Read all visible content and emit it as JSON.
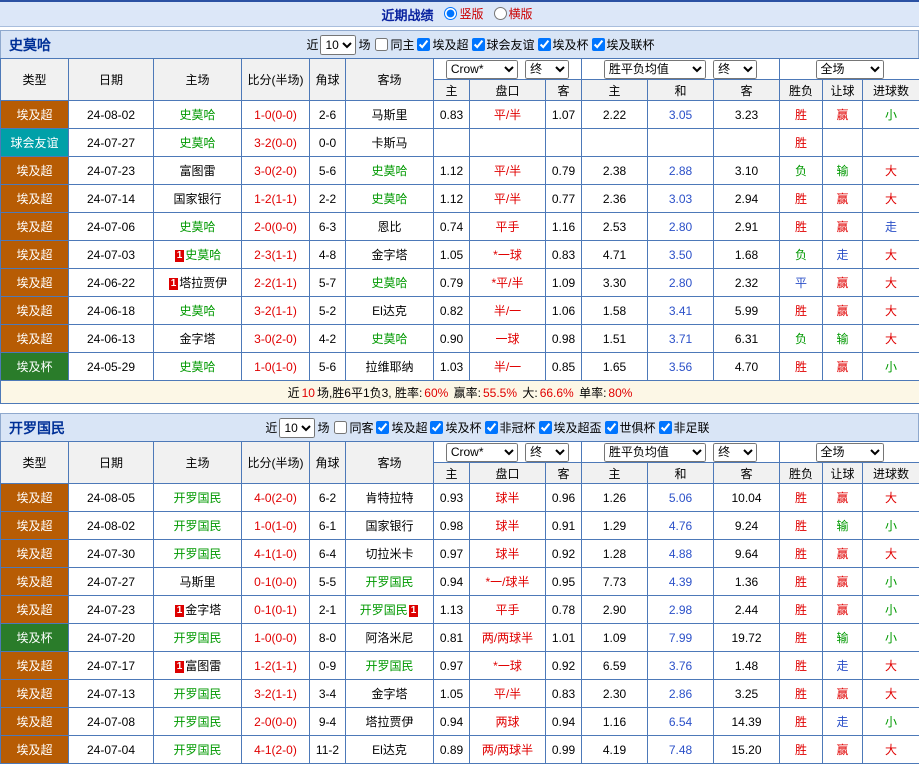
{
  "topbar": {
    "title": "近期战绩",
    "layout_options": [
      {
        "label": "竖版",
        "selected": true
      },
      {
        "label": "横版",
        "selected": false
      }
    ]
  },
  "colors": {
    "accent_red": "#e00000",
    "accent_green": "#009900",
    "accent_blue": "#2b50c8",
    "league_super_bg": "#b75c04",
    "league_friendly_bg": "#00a0a8",
    "league_cup_bg": "#2a7c2a",
    "bar_bg": "#d9e5f6",
    "table_border": "#4d79b8",
    "title_blue": "#0a23a0"
  },
  "table_header": {
    "cols": [
      "类型",
      "日期",
      "主场",
      "比分(半场)",
      "角球",
      "客场"
    ],
    "provider": "Crow*",
    "final": "终",
    "europe_avg": "胜平负均值",
    "full": "全场",
    "sub": [
      "主",
      "盘口",
      "客",
      "主",
      "和",
      "客",
      "胜负",
      "让球",
      "进球数"
    ]
  },
  "sections": [
    {
      "team": "史莫哈",
      "filter": {
        "near_label": "近",
        "games_value": "10",
        "games_label": "场",
        "checkboxes": [
          {
            "label": "同主",
            "checked": false
          },
          {
            "label": "埃及超",
            "checked": true
          },
          {
            "label": "球会友谊",
            "checked": true
          },
          {
            "label": "埃及杯",
            "checked": true
          },
          {
            "label": "埃及联杯",
            "checked": true
          }
        ]
      },
      "rows": [
        {
          "type": "埃及超",
          "league": "super",
          "date": "24-08-02",
          "home": {
            "name": "史莫哈",
            "self": true
          },
          "score": "1-0(0-0)",
          "corner": "2-6",
          "away": {
            "name": "马斯里",
            "self": false
          },
          "asia": [
            "0.83",
            "平/半",
            "1.07"
          ],
          "europe": [
            "2.22",
            "3.05",
            "3.23"
          ],
          "spf": [
            "胜",
            "w"
          ],
          "rq": [
            "赢",
            "w"
          ],
          "dx": [
            "小",
            "l"
          ]
        },
        {
          "type": "球会友谊",
          "league": "friendly",
          "date": "24-07-27",
          "home": {
            "name": "史莫哈",
            "self": true
          },
          "score": "3-2(0-0)",
          "corner": "0-0",
          "away": {
            "name": "卡斯马",
            "self": false
          },
          "asia": [
            "",
            "",
            ""
          ],
          "europe": [
            "",
            "",
            ""
          ],
          "spf": [
            "胜",
            "w"
          ],
          "rq": [
            "",
            ""
          ],
          "dx": [
            "",
            ""
          ]
        },
        {
          "type": "埃及超",
          "league": "super",
          "date": "24-07-23",
          "home": {
            "name": "富图雷",
            "self": false
          },
          "score": "3-0(2-0)",
          "corner": "5-6",
          "away": {
            "name": "史莫哈",
            "self": true
          },
          "asia": [
            "1.12",
            "平/半",
            "0.79"
          ],
          "europe": [
            "2.38",
            "2.88",
            "3.10"
          ],
          "spf": [
            "负",
            "l"
          ],
          "rq": [
            "输",
            "l"
          ],
          "dx": [
            "大",
            "w"
          ]
        },
        {
          "type": "埃及超",
          "league": "super",
          "date": "24-07-14",
          "home": {
            "name": "国家银行",
            "self": false
          },
          "score": "1-2(1-1)",
          "corner": "2-2",
          "away": {
            "name": "史莫哈",
            "self": true
          },
          "asia": [
            "1.12",
            "平/半",
            "0.77"
          ],
          "europe": [
            "2.36",
            "3.03",
            "2.94"
          ],
          "spf": [
            "胜",
            "w"
          ],
          "rq": [
            "赢",
            "w"
          ],
          "dx": [
            "大",
            "w"
          ]
        },
        {
          "type": "埃及超",
          "league": "super",
          "date": "24-07-06",
          "home": {
            "name": "史莫哈",
            "self": true
          },
          "score": "2-0(0-0)",
          "corner": "6-3",
          "away": {
            "name": "恩比",
            "self": false
          },
          "asia": [
            "0.74",
            "平手",
            "1.16"
          ],
          "europe": [
            "2.53",
            "2.80",
            "2.91"
          ],
          "spf": [
            "胜",
            "w"
          ],
          "rq": [
            "赢",
            "w"
          ],
          "dx": [
            "走",
            "d"
          ]
        },
        {
          "type": "埃及超",
          "league": "super",
          "date": "24-07-03",
          "home": {
            "name": "史莫哈",
            "self": true,
            "badge_pre": "1"
          },
          "score": "2-3(1-1)",
          "corner": "4-8",
          "away": {
            "name": "金字塔",
            "self": false
          },
          "asia": [
            "1.05",
            "*一球",
            "0.83"
          ],
          "europe": [
            "4.71",
            "3.50",
            "1.68"
          ],
          "spf": [
            "负",
            "l"
          ],
          "rq": [
            "走",
            "d"
          ],
          "dx": [
            "大",
            "w"
          ]
        },
        {
          "type": "埃及超",
          "league": "super",
          "date": "24-06-22",
          "home": {
            "name": "塔拉贾伊",
            "self": false,
            "badge_pre": "1"
          },
          "score": "2-2(1-1)",
          "corner": "5-7",
          "away": {
            "name": "史莫哈",
            "self": true
          },
          "asia": [
            "0.79",
            "*平/半",
            "1.09"
          ],
          "europe": [
            "3.30",
            "2.80",
            "2.32"
          ],
          "spf": [
            "平",
            "d"
          ],
          "rq": [
            "赢",
            "w"
          ],
          "dx": [
            "大",
            "w"
          ]
        },
        {
          "type": "埃及超",
          "league": "super",
          "date": "24-06-18",
          "home": {
            "name": "史莫哈",
            "self": true
          },
          "score": "3-2(1-1)",
          "corner": "5-2",
          "away": {
            "name": "El达克",
            "self": false
          },
          "asia": [
            "0.82",
            "半/一",
            "1.06"
          ],
          "europe": [
            "1.58",
            "3.41",
            "5.99"
          ],
          "spf": [
            "胜",
            "w"
          ],
          "rq": [
            "赢",
            "w"
          ],
          "dx": [
            "大",
            "w"
          ]
        },
        {
          "type": "埃及超",
          "league": "super",
          "date": "24-06-13",
          "home": {
            "name": "金字塔",
            "self": false
          },
          "score": "3-0(2-0)",
          "corner": "4-2",
          "away": {
            "name": "史莫哈",
            "self": true
          },
          "asia": [
            "0.90",
            "一球",
            "0.98"
          ],
          "europe": [
            "1.51",
            "3.71",
            "6.31"
          ],
          "spf": [
            "负",
            "l"
          ],
          "rq": [
            "输",
            "l"
          ],
          "dx": [
            "大",
            "w"
          ]
        },
        {
          "type": "埃及杯",
          "league": "cup",
          "date": "24-05-29",
          "home": {
            "name": "史莫哈",
            "self": true
          },
          "score": "1-0(1-0)",
          "corner": "5-6",
          "away": {
            "name": "拉维耶纳",
            "self": false
          },
          "asia": [
            "1.03",
            "半/一",
            "0.85"
          ],
          "europe": [
            "1.65",
            "3.56",
            "4.70"
          ],
          "spf": [
            "胜",
            "w"
          ],
          "rq": [
            "赢",
            "w"
          ],
          "dx": [
            "小",
            "l"
          ]
        }
      ],
      "summary": [
        [
          "近",
          0
        ],
        [
          "10",
          1
        ],
        [
          "场,胜6平1负3, 胜率:",
          0
        ],
        [
          "60%",
          1
        ],
        [
          " 赢率:",
          0
        ],
        [
          "55.5%",
          1
        ],
        [
          " 大:",
          0
        ],
        [
          "66.6%",
          1
        ],
        [
          " 单率:",
          0
        ],
        [
          "80%",
          1
        ]
      ]
    },
    {
      "team": "开罗国民",
      "filter": {
        "near_label": "近",
        "games_value": "10",
        "games_label": "场",
        "checkboxes": [
          {
            "label": "同客",
            "checked": false
          },
          {
            "label": "埃及超",
            "checked": true
          },
          {
            "label": "埃及杯",
            "checked": true
          },
          {
            "label": "非冠杯",
            "checked": true
          },
          {
            "label": "埃及超盃",
            "checked": true
          },
          {
            "label": "世俱杯",
            "checked": true
          },
          {
            "label": "非足联",
            "checked": true
          }
        ]
      },
      "rows": [
        {
          "type": "埃及超",
          "league": "super",
          "date": "24-08-05",
          "home": {
            "name": "开罗国民",
            "self": true
          },
          "score": "4-0(2-0)",
          "corner": "6-2",
          "away": {
            "name": "肯特拉特",
            "self": false
          },
          "asia": [
            "0.93",
            "球半",
            "0.96"
          ],
          "europe": [
            "1.26",
            "5.06",
            "10.04"
          ],
          "spf": [
            "胜",
            "w"
          ],
          "rq": [
            "赢",
            "w"
          ],
          "dx": [
            "大",
            "w"
          ]
        },
        {
          "type": "埃及超",
          "league": "super",
          "date": "24-08-02",
          "home": {
            "name": "开罗国民",
            "self": true
          },
          "score": "1-0(1-0)",
          "corner": "6-1",
          "away": {
            "name": "国家银行",
            "self": false
          },
          "asia": [
            "0.98",
            "球半",
            "0.91"
          ],
          "europe": [
            "1.29",
            "4.76",
            "9.24"
          ],
          "spf": [
            "胜",
            "w"
          ],
          "rq": [
            "输",
            "l"
          ],
          "dx": [
            "小",
            "l"
          ]
        },
        {
          "type": "埃及超",
          "league": "super",
          "date": "24-07-30",
          "home": {
            "name": "开罗国民",
            "self": true
          },
          "score": "4-1(1-0)",
          "corner": "6-4",
          "away": {
            "name": "切拉米卡",
            "self": false
          },
          "asia": [
            "0.97",
            "球半",
            "0.92"
          ],
          "europe": [
            "1.28",
            "4.88",
            "9.64"
          ],
          "spf": [
            "胜",
            "w"
          ],
          "rq": [
            "赢",
            "w"
          ],
          "dx": [
            "大",
            "w"
          ]
        },
        {
          "type": "埃及超",
          "league": "super",
          "date": "24-07-27",
          "home": {
            "name": "马斯里",
            "self": false
          },
          "score": "0-1(0-0)",
          "corner": "5-5",
          "away": {
            "name": "开罗国民",
            "self": true
          },
          "asia": [
            "0.94",
            "*一/球半",
            "0.95"
          ],
          "europe": [
            "7.73",
            "4.39",
            "1.36"
          ],
          "spf": [
            "胜",
            "w"
          ],
          "rq": [
            "赢",
            "w"
          ],
          "dx": [
            "小",
            "l"
          ]
        },
        {
          "type": "埃及超",
          "league": "super",
          "date": "24-07-23",
          "home": {
            "name": "金字塔",
            "self": false,
            "badge_pre": "1"
          },
          "score": "0-1(0-1)",
          "corner": "2-1",
          "away": {
            "name": "开罗国民",
            "self": true,
            "badge_post": "1"
          },
          "asia": [
            "1.13",
            "平手",
            "0.78"
          ],
          "europe": [
            "2.90",
            "2.98",
            "2.44"
          ],
          "spf": [
            "胜",
            "w"
          ],
          "rq": [
            "赢",
            "w"
          ],
          "dx": [
            "小",
            "l"
          ]
        },
        {
          "type": "埃及杯",
          "league": "cup",
          "date": "24-07-20",
          "home": {
            "name": "开罗国民",
            "self": true
          },
          "score": "1-0(0-0)",
          "corner": "8-0",
          "away": {
            "name": "阿洛米尼",
            "self": false
          },
          "asia": [
            "0.81",
            "两/两球半",
            "1.01"
          ],
          "europe": [
            "1.09",
            "7.99",
            "19.72"
          ],
          "spf": [
            "胜",
            "w"
          ],
          "rq": [
            "输",
            "l"
          ],
          "dx": [
            "小",
            "l"
          ]
        },
        {
          "type": "埃及超",
          "league": "super",
          "date": "24-07-17",
          "home": {
            "name": "富图雷",
            "self": false,
            "badge_pre": "1"
          },
          "score": "1-2(1-1)",
          "corner": "0-9",
          "away": {
            "name": "开罗国民",
            "self": true
          },
          "asia": [
            "0.97",
            "*一球",
            "0.92"
          ],
          "europe": [
            "6.59",
            "3.76",
            "1.48"
          ],
          "spf": [
            "胜",
            "w"
          ],
          "rq": [
            "走",
            "d"
          ],
          "dx": [
            "大",
            "w"
          ]
        },
        {
          "type": "埃及超",
          "league": "super",
          "date": "24-07-13",
          "home": {
            "name": "开罗国民",
            "self": true
          },
          "score": "3-2(1-1)",
          "corner": "3-4",
          "away": {
            "name": "金字塔",
            "self": false
          },
          "asia": [
            "1.05",
            "平/半",
            "0.83"
          ],
          "europe": [
            "2.30",
            "2.86",
            "3.25"
          ],
          "spf": [
            "胜",
            "w"
          ],
          "rq": [
            "赢",
            "w"
          ],
          "dx": [
            "大",
            "w"
          ]
        },
        {
          "type": "埃及超",
          "league": "super",
          "date": "24-07-08",
          "home": {
            "name": "开罗国民",
            "self": true
          },
          "score": "2-0(0-0)",
          "corner": "9-4",
          "away": {
            "name": "塔拉贾伊",
            "self": false
          },
          "asia": [
            "0.94",
            "两球",
            "0.94"
          ],
          "europe": [
            "1.16",
            "6.54",
            "14.39"
          ],
          "spf": [
            "胜",
            "w"
          ],
          "rq": [
            "走",
            "d"
          ],
          "dx": [
            "小",
            "l"
          ]
        },
        {
          "type": "埃及超",
          "league": "super",
          "date": "24-07-04",
          "home": {
            "name": "开罗国民",
            "self": true
          },
          "score": "4-1(2-0)",
          "corner": "11-2",
          "away": {
            "name": "El达克",
            "self": false
          },
          "asia": [
            "0.89",
            "两/两球半",
            "0.99"
          ],
          "europe": [
            "4.19",
            "7.48",
            "15.20"
          ],
          "spf": [
            "胜",
            "w"
          ],
          "rq": [
            "赢",
            "w"
          ],
          "dx": [
            "大",
            "w"
          ]
        }
      ],
      "summary": null
    }
  ]
}
